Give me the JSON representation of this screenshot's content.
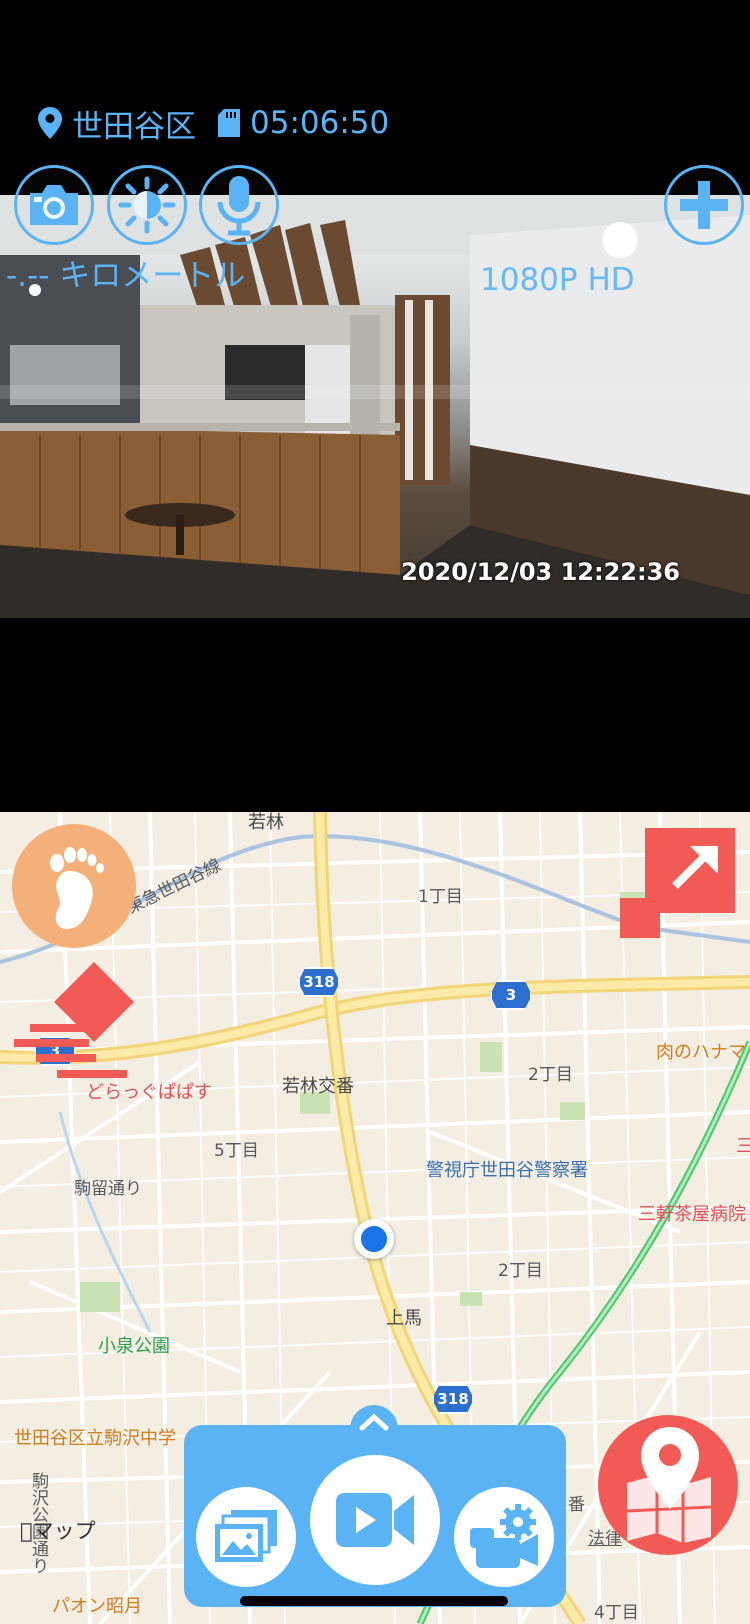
{
  "status": {
    "location": "世田谷区",
    "recording_time": "05:06:50",
    "accent_color": "#5ab3f5"
  },
  "camera": {
    "timestamp": "2020/12/03  12:22:36",
    "distance": "-.-- キロメートル",
    "resolution": "1080P HD",
    "buttons": [
      "camera-icon",
      "brightness-icon",
      "microphone-icon",
      "plus-icon"
    ]
  },
  "map": {
    "labels": {
      "wakabayashi_top": "若林",
      "tokyu_line": "東急世田谷線",
      "chome1": "1丁目",
      "route318_top": "318",
      "route3_right": "3",
      "route3_left": "3",
      "niku_shop": "肉のハナマ",
      "drugstore": "どらっぐぱぱす",
      "wakabayashi_koban": "若林交番",
      "chome2_upper": "2丁目",
      "chome5": "5丁目",
      "komadome": "駒留通り",
      "police": "警視庁世田谷警察署",
      "sangenjaya_hospital": "三軒茶屋病院",
      "chome2_lower": "2丁目",
      "kamiuma": "上馬",
      "koizumi_park": "小泉公園",
      "route318_bottom": "318",
      "komazawa_school": "世田谷区立駒沢中学",
      "komazawa_park_st": "駒沢公園通り",
      "ban": "番",
      "law_office": "法律",
      "aeon": "パオン昭月",
      "chome4": "4丁目",
      "san": "三"
    },
    "attribution": "マップ",
    "location_dot_color": "#1a73e8",
    "action_color": "#f25a56"
  },
  "bottom_bar": {
    "buttons": [
      "gallery-icon",
      "video-record-icon",
      "settings-icon"
    ],
    "handle_icon": "chevron-up-icon"
  }
}
